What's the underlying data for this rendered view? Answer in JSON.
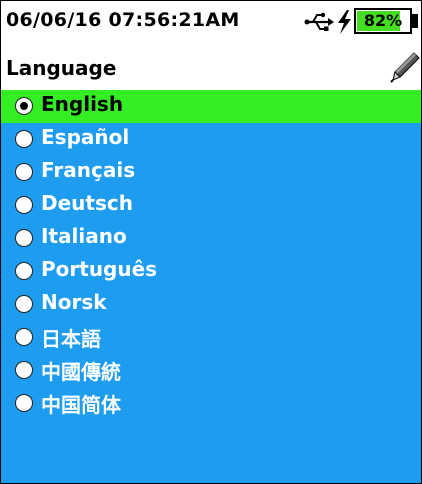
{
  "status_bar": {
    "datetime": "06/06/16  07:56:21AM",
    "battery_percent_label": "82%",
    "battery_level": 0.82,
    "icons": [
      "usb-icon",
      "charging-bolt-icon",
      "battery-icon"
    ]
  },
  "header": {
    "title": "Language",
    "edit_icon": "pen-icon"
  },
  "languages": {
    "selected_index": 0,
    "items": [
      {
        "label": "English"
      },
      {
        "label": "Español"
      },
      {
        "label": "Français"
      },
      {
        "label": "Deutsch"
      },
      {
        "label": "Italiano"
      },
      {
        "label": "Português"
      },
      {
        "label": "Norsk"
      },
      {
        "label": "日本語"
      },
      {
        "label": "中國傳統"
      },
      {
        "label": "中国简体"
      }
    ]
  },
  "colors": {
    "list_background": "#1d9cf0",
    "selected_background": "#33ee22",
    "battery_fill": "#44dd22"
  }
}
